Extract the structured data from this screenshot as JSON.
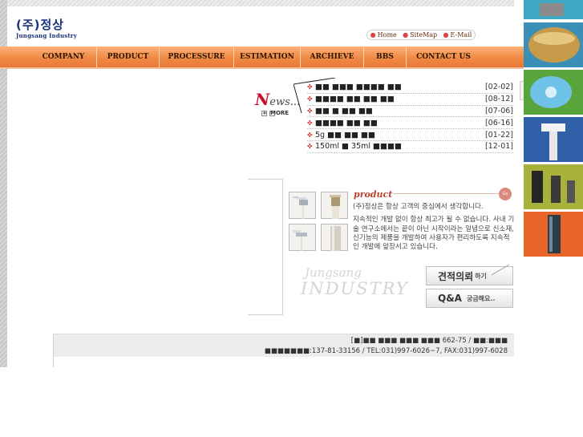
{
  "header": {
    "logo_main": "(주)정상",
    "logo_sub": "Jungsang Industry",
    "links": [
      "Home",
      "SiteMap",
      "E-Mail"
    ]
  },
  "nav": {
    "items": [
      "COMPANY",
      "PRODUCT",
      "PROCESSURE",
      "ESTIMATION",
      "ARCHIEVE",
      "BBS",
      "CONTACT US"
    ]
  },
  "news": {
    "logo_initial": "N",
    "logo_rest": "ews...",
    "more_label": "MORE",
    "items": [
      {
        "title": "■■ ■■■ ■■■■ ■■",
        "date": "[02-02]"
      },
      {
        "title": "■■■■ ■■ ■■ ■■",
        "date": "[08-12]"
      },
      {
        "title": "■■ ■ ■■ ■■",
        "date": "[07-06]"
      },
      {
        "title": "■■■■ ■■ ■■",
        "date": "[06-16]"
      },
      {
        "title": "5g ■■ ■■ ■■",
        "date": "[01-22]"
      },
      {
        "title": "150ml ■ 35ml ■■■■",
        "date": "[12-01]"
      }
    ]
  },
  "product": {
    "title": "product",
    "go_label": "Go",
    "paragraph1": "(주)정상은 항상 고객의 중심에서 생각합니다.",
    "paragraph2": "지속적인 개발 없이 항상 최고가 될 수 없습니다. 사내 기술 연구소에서는 끝이 아닌 시작이라는 일념으로 신소재, 신기능의 제품을 개발하여 사용자가 편리하도록 지속적인 개발에 앞장서고 있습니다."
  },
  "watermark": {
    "line1": "Jungsang",
    "line2": "INDUSTRY"
  },
  "buttons": {
    "estimate_main": "견적의뢰",
    "estimate_sub": "하기",
    "qa_main": "Q&A",
    "qa_sub": "궁금해요.."
  },
  "footer": {
    "line1": "[■]■■  ■■■ ■■■ ■■■ 662-75 / ■■:■■■",
    "line2": "■■■■■■■:137-81-33156 / TEL:031)997-6026~7, FAX:031)997-6028"
  },
  "colors": {
    "nav_orange": "#f08a45",
    "brand_navy": "#1b2f7a",
    "accent_red": "#c8102e"
  }
}
